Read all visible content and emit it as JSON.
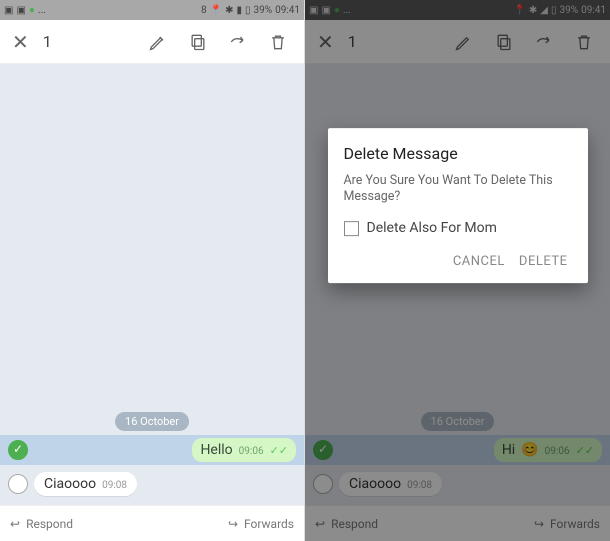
{
  "status": {
    "battery_text": "39%",
    "time": "09:41",
    "left_extra_left": "8"
  },
  "actionbar": {
    "selected_count": "1"
  },
  "chat": {
    "date_chip": "16 October",
    "out_left": {
      "text": "Hello",
      "time": "09:06"
    },
    "out_right": {
      "text": "Hi",
      "time": "09:06"
    },
    "in_msg": {
      "text": "Ciaoooo",
      "time": "09:08"
    }
  },
  "bottombar": {
    "respond": "Respond",
    "forwards": "Forwards"
  },
  "dialog": {
    "title": "Delete Message",
    "body": "Are You Sure You Want To Delete This Message?",
    "checkbox_label": "Delete Also For Mom",
    "cancel": "CANCEL",
    "delete": "DELETE"
  }
}
